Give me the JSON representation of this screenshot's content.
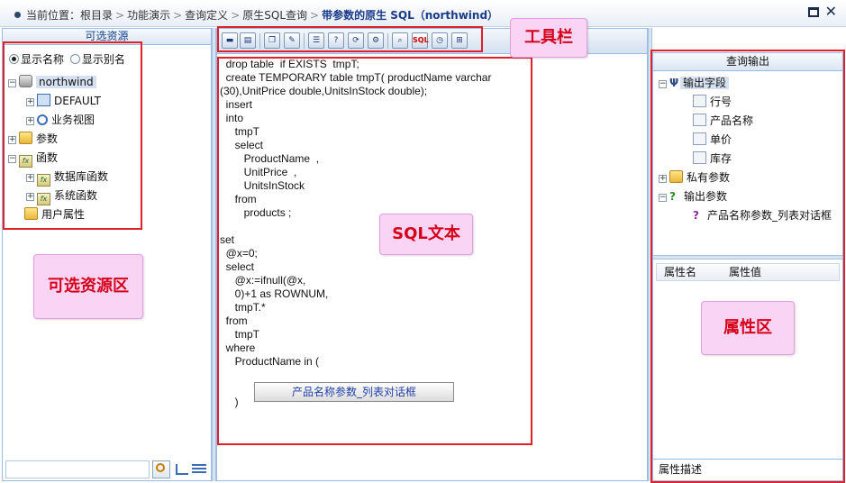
{
  "breadcrumb": {
    "prefix": "当前位置：",
    "items": [
      "根目录",
      "功能演示",
      "查询定义",
      "原生SQL查询"
    ],
    "current": "带参数的原生 SQL（northwind）"
  },
  "left": {
    "title": "可选资源",
    "radio_show_name": "显示名称",
    "radio_show_alias": "显示别名",
    "tree": {
      "root": "northwind",
      "default": "DEFAULT",
      "business_view": "业务视图",
      "params": "参数",
      "functions": "函数",
      "db_functions": "数据库函数",
      "sys_functions": "系统函数",
      "user_props": "用户属性"
    }
  },
  "center": {
    "sql_lines": [
      "  drop table  if EXISTS  tmpT;",
      "  create TEMPORARY table tmpT( productName varchar",
      "(30),UnitPrice double,UnitsInStock double);",
      "  insert",
      "  into",
      "     tmpT",
      "     select",
      "        ProductName  ,",
      "        UnitPrice  ,",
      "        UnitsInStock",
      "     from",
      "        products ;",
      "",
      "set",
      "  @x=0;",
      "  select",
      "     @x:=ifnull(@x,",
      "     0)+1 as ROWNUM,",
      "     tmpT.*",
      "  from",
      "     tmpT",
      "  where",
      "     ProductName in (",
      "",
      "",
      "     )"
    ],
    "param_button": "产品名称参数_列表对话框"
  },
  "right": {
    "title": "查询输出",
    "output_fields": "输出字段",
    "fields": [
      "行号",
      "产品名称",
      "单价",
      "库存"
    ],
    "private_params": "私有参数",
    "output_params": "输出参数",
    "output_param_item": "产品名称参数_列表对话框",
    "prop_name": "属性名",
    "prop_value": "属性值",
    "prop_desc": "属性描述"
  },
  "callouts": {
    "toolbar": "工具栏",
    "sql": "SQL文本",
    "resources": "可选资源区",
    "properties": "属性区"
  },
  "colors": {
    "annotation_border": "#e0202a",
    "callout_bg": "#f9d4f4",
    "callout_text": "#d4001a",
    "panel_border": "#99bbe8"
  }
}
